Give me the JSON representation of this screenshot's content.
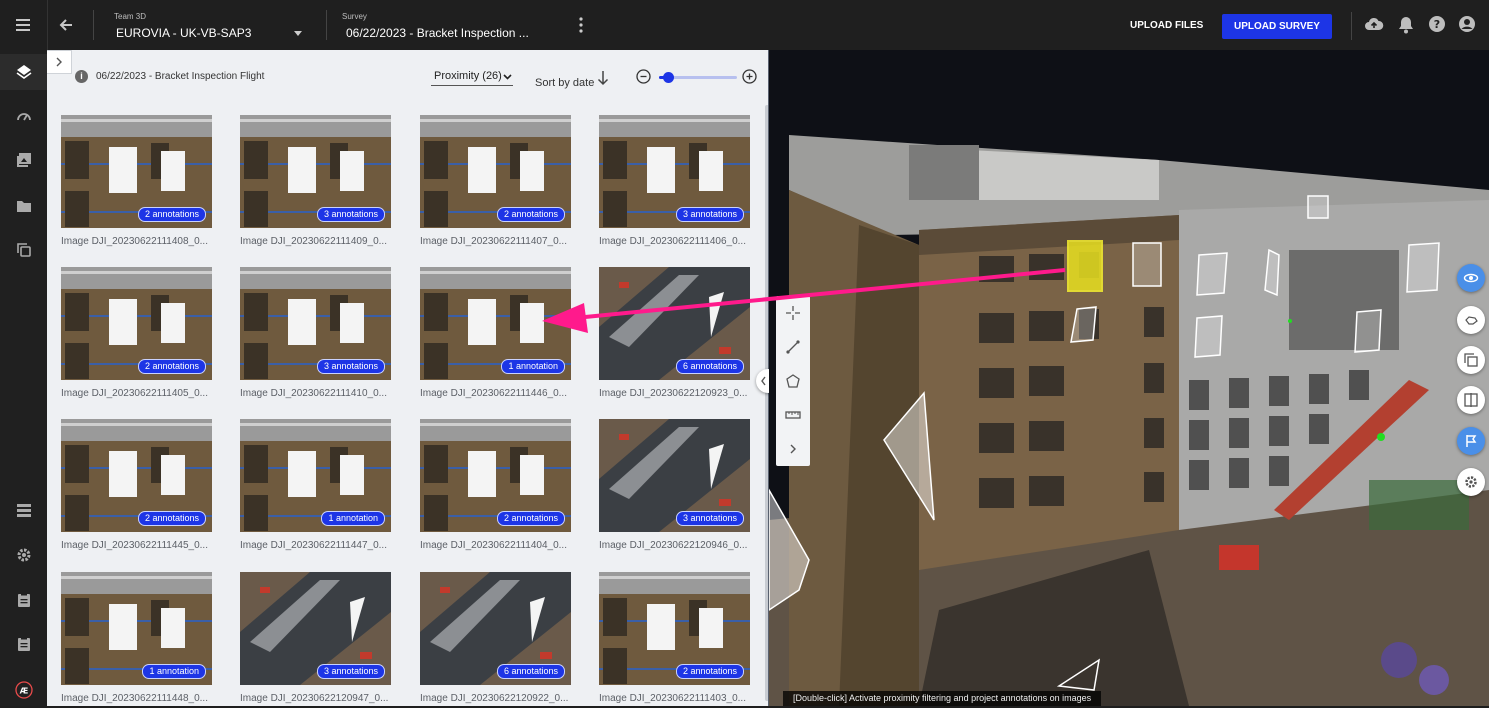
{
  "colors": {
    "accent": "#1d35e6",
    "annotation_arrow": "#ff1a8c",
    "topbar": "#1f1f1f",
    "panel_bg": "#eef0f3"
  },
  "topbar": {
    "menu_icon": "hamburger-icon",
    "back_icon": "arrow-left-icon",
    "team_label": "Team 3D",
    "team_value": "EUROVIA - UK-VB-SAP3",
    "survey_label": "Survey",
    "survey_value": "06/22/2023 - Bracket Inspection ...",
    "upload_files": "UPLOAD FILES",
    "upload_survey": "UPLOAD SURVEY"
  },
  "panel": {
    "title": "06/22/2023 - Bracket Inspection Flight",
    "filter_value": "Proximity (26)",
    "sort_label": "Sort by date",
    "zoom_level": 0.1
  },
  "images": [
    {
      "caption": "Image DJI_20230622111408_0...",
      "badge": "2 annotations",
      "kind": "facade"
    },
    {
      "caption": "Image DJI_20230622111409_0...",
      "badge": "3 annotations",
      "kind": "facade"
    },
    {
      "caption": "Image DJI_20230622111407_0...",
      "badge": "2 annotations",
      "kind": "facade"
    },
    {
      "caption": "Image DJI_20230622111406_0...",
      "badge": "3 annotations",
      "kind": "facade"
    },
    {
      "caption": "Image DJI_20230622111405_0...",
      "badge": "2 annotations",
      "kind": "facade"
    },
    {
      "caption": "Image DJI_20230622111410_0...",
      "badge": "3 annotations",
      "kind": "facade"
    },
    {
      "caption": "Image DJI_20230622111446_0...",
      "badge": "1 annotation",
      "kind": "facade"
    },
    {
      "caption": "Image DJI_20230622120923_0...",
      "badge": "6 annotations",
      "kind": "aerial"
    },
    {
      "caption": "Image DJI_20230622111445_0...",
      "badge": "2 annotations",
      "kind": "facade"
    },
    {
      "caption": "Image DJI_20230622111447_0...",
      "badge": "1 annotation",
      "kind": "facade"
    },
    {
      "caption": "Image DJI_20230622111404_0...",
      "badge": "2 annotations",
      "kind": "facade"
    },
    {
      "caption": "Image DJI_20230622120946_0...",
      "badge": "3 annotations",
      "kind": "aerial"
    },
    {
      "caption": "Image DJI_20230622111448_0...",
      "badge": "1 annotation",
      "kind": "facade"
    },
    {
      "caption": "Image DJI_20230622120947_0...",
      "badge": "3 annotations",
      "kind": "aerial"
    },
    {
      "caption": "Image DJI_20230622120922_0...",
      "badge": "6 annotations",
      "kind": "aerial"
    },
    {
      "caption": "Image DJI_20230622111403_0...",
      "badge": "2 annotations",
      "kind": "facade"
    }
  ],
  "viewer": {
    "hint": "[Double-click] Activate proximity filtering and project annotations on images"
  }
}
